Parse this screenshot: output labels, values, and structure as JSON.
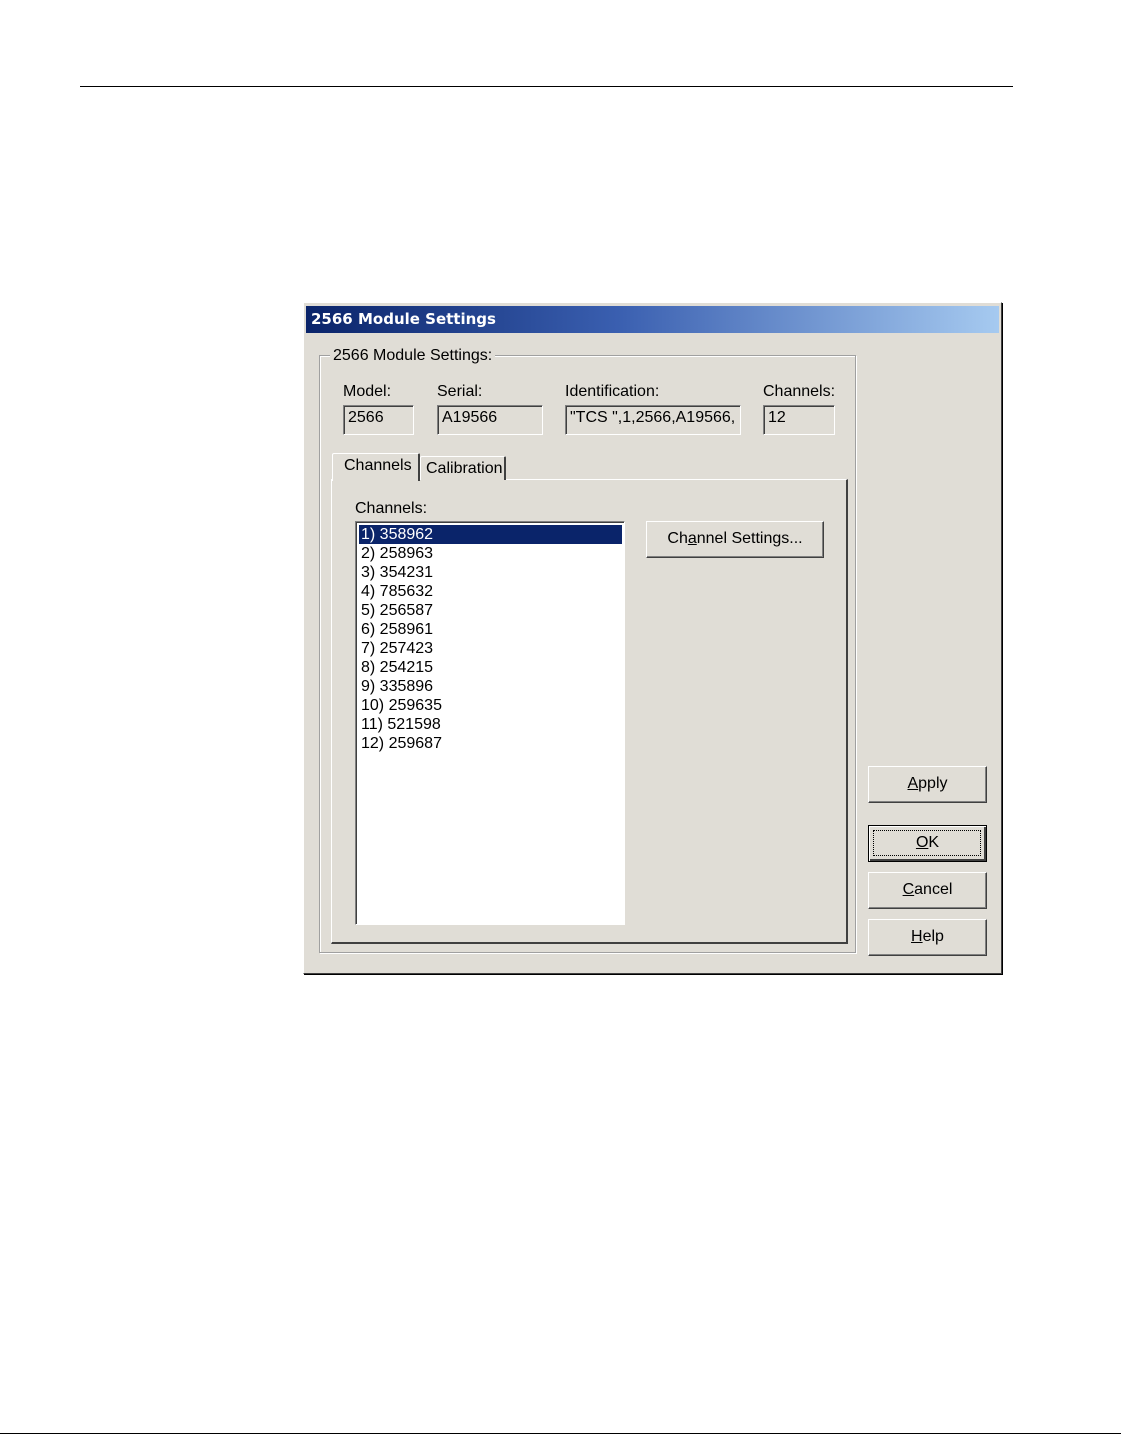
{
  "dialog": {
    "title": "2566 Module Settings",
    "group_label": "2566 Module Settings:",
    "fields": {
      "model": {
        "label": "Model:",
        "value": "2566"
      },
      "serial": {
        "label": "Serial:",
        "value": "A19566"
      },
      "identification": {
        "label": "Identification:",
        "value": "\"TCS \",1,2566,A19566,"
      },
      "channels": {
        "label": "Channels:",
        "value": "12"
      }
    },
    "tabs": [
      {
        "label": "Channels",
        "active": true
      },
      {
        "label": "Calibration",
        "active": false
      }
    ],
    "channels_list_label": "Channels:",
    "channel_list": [
      "1) 358962",
      "2) 258963",
      "3) 354231",
      "4) 785632",
      "5) 256587",
      "6) 258961",
      "7) 257423",
      "8) 254215",
      "9) 335896",
      "10) 259635",
      "11) 521598",
      "12) 259687"
    ],
    "selected_channel_index": 0,
    "buttons": {
      "channel_settings": {
        "pre": "Ch",
        "accel": "a",
        "post": "nnel Settings..."
      },
      "apply": {
        "pre": "",
        "accel": "A",
        "post": "pply"
      },
      "ok": {
        "pre": "",
        "accel": "O",
        "post": "K"
      },
      "cancel": {
        "pre": "",
        "accel": "C",
        "post": "ancel"
      },
      "help": {
        "pre": "",
        "accel": "H",
        "post": "elp"
      }
    }
  },
  "colors": {
    "dialog_face": "#e0ddd6",
    "title_gradient_start": "#0a246a",
    "title_gradient_end": "#a6caf0",
    "selection": "#0a246a"
  }
}
